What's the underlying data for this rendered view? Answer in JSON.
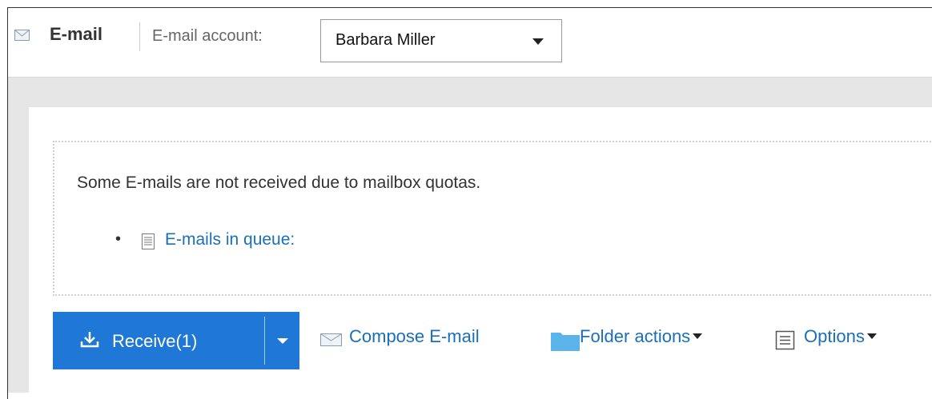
{
  "header": {
    "app_icon": "envelope-icon",
    "app_title": "E-mail",
    "account_label": "E-mail account:",
    "account_selected": "Barbara Miller"
  },
  "notice": {
    "message": "Some E-mails are not received due to mailbox quotas.",
    "bullet": "•",
    "queue_icon": "document-icon",
    "queue_link": "E-mails in queue:"
  },
  "toolbar": {
    "receive_icon": "download-icon",
    "receive_label": "Receive(1)",
    "compose_icon": "envelope-icon",
    "compose_label": "Compose E-mail",
    "folder_icon": "folder-icon",
    "folder_label": "Folder actions",
    "options_icon": "list-icon",
    "options_label": "Options"
  },
  "colors": {
    "accent": "#1f77d6",
    "link": "#1a6fb8",
    "background_band": "#e6e6e6",
    "folder": "#5ab4ea"
  }
}
